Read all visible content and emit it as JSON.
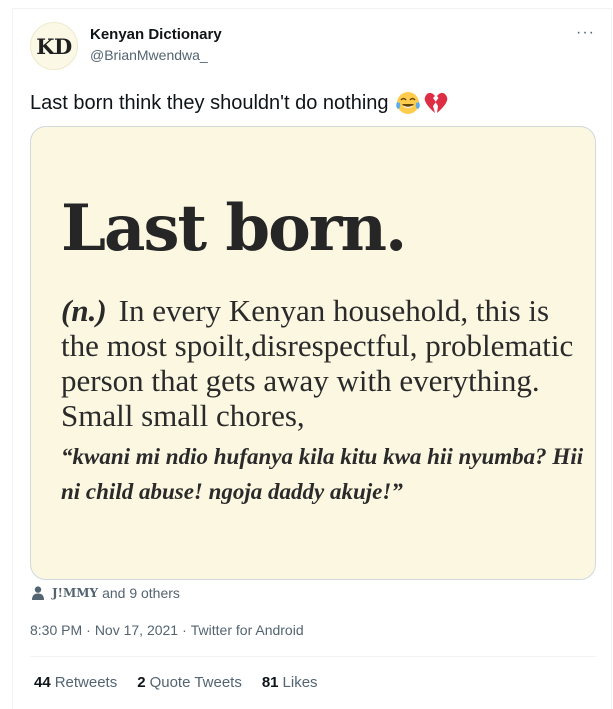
{
  "tweet": {
    "author": {
      "avatar_text": "KD",
      "name": "Kenyan Dictionary",
      "handle": "@BrianMwendwa_"
    },
    "more_label": "···",
    "text": "Last born think they shouldn't do nothing",
    "emojis": [
      "face-with-tears-of-joy-icon",
      "broken-heart-icon"
    ],
    "media": {
      "title": "Last born.",
      "part_of_speech": "(n.)",
      "definition": "In every Kenyan household, this is the most spoilt,disrespectful, problematic person that gets away with everything. Small small chores,",
      "quote": "“kwani mi ndio hufanya kila kitu kwa hii nyumba? Hii ni child abuse! ngoja daddy akuje!”"
    },
    "liked_by": {
      "name": "J!MMY",
      "suffix": "and 9 others"
    },
    "meta": {
      "time": "8:30 PM",
      "sep1": "·",
      "date": "Nov 17, 2021",
      "sep2": "·",
      "source": "Twitter for Android"
    },
    "stats": {
      "retweets_count": "44",
      "retweets_label": "Retweets",
      "quotes_count": "2",
      "quotes_label": "Quote Tweets",
      "likes_count": "81",
      "likes_label": "Likes"
    }
  },
  "colors": {
    "text_primary": "#0f1419",
    "text_secondary": "#536471",
    "media_bg": "#fbf7e1",
    "divider": "#eff3f4"
  }
}
